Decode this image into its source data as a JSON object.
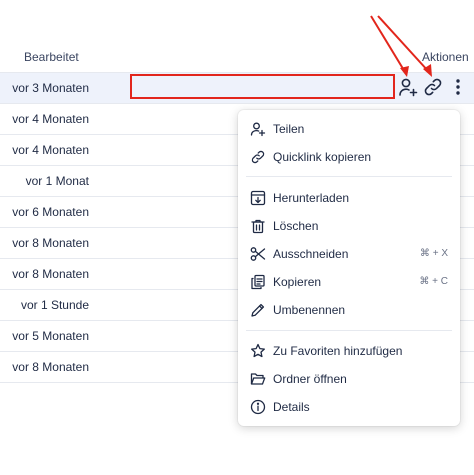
{
  "header": {
    "modified": "Bearbeitet",
    "actions": "Aktionen"
  },
  "rows": [
    {
      "modified": "vor 3 Monaten"
    },
    {
      "modified": "vor 4 Monaten"
    },
    {
      "modified": "vor 4 Monaten"
    },
    {
      "modified": "vor 1 Monat"
    },
    {
      "modified": "vor 6 Monaten"
    },
    {
      "modified": "vor 8 Monaten"
    },
    {
      "modified": "vor 8 Monaten"
    },
    {
      "modified": "vor 1 Stunde"
    },
    {
      "modified": "vor 5 Monaten"
    },
    {
      "modified": "vor 8 Monaten"
    }
  ],
  "row_actions": {
    "share": "share-user-icon",
    "quicklink": "link-icon",
    "more": "more-vertical-icon"
  },
  "annotation_color": "#e2261c",
  "context_menu": {
    "share": "Teilen",
    "quicklink": "Quicklink kopieren",
    "download": "Herunterladen",
    "delete": "Löschen",
    "cut": "Ausschneiden",
    "cut_shortcut": "⌘ + X",
    "copy": "Kopieren",
    "copy_shortcut": "⌘ + C",
    "rename": "Umbenennen",
    "favorite": "Zu Favoriten hinzufügen",
    "open_folder": "Ordner öffnen",
    "details": "Details"
  }
}
